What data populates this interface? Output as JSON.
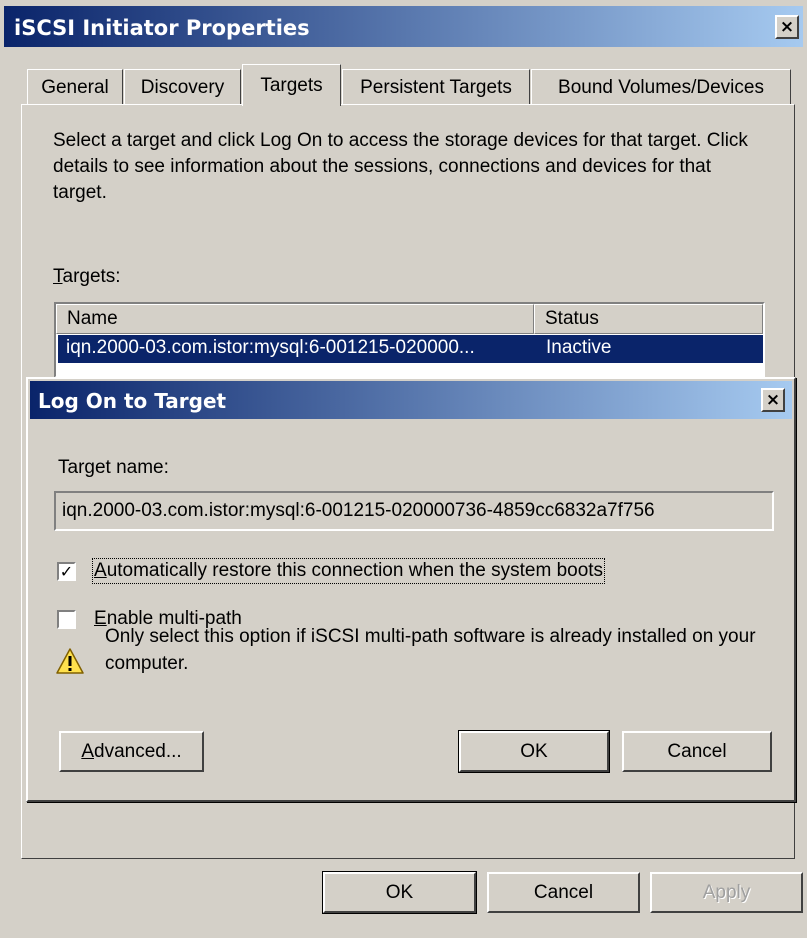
{
  "window": {
    "title": "iSCSI Initiator Properties",
    "close_label": "×",
    "tabs": [
      {
        "label": "General"
      },
      {
        "label": "Discovery"
      },
      {
        "label": "Targets"
      },
      {
        "label": "Persistent Targets"
      },
      {
        "label": "Bound Volumes/Devices"
      }
    ],
    "selected_tab": "Targets",
    "description": "Select a target and click Log On to access the storage devices for that target. Click details to see information about the sessions, connections and devices for that target.",
    "targets_label": {
      "mnemonic": "T",
      "rest": "argets:"
    },
    "list": {
      "columns": [
        "Name",
        "Status"
      ],
      "rows": [
        {
          "name": "iqn.2000-03.com.istor:mysql:6-001215-020000...",
          "status": "Inactive"
        }
      ]
    },
    "buttons": {
      "ok": "OK",
      "cancel": "Cancel",
      "apply": "Apply"
    }
  },
  "dialog": {
    "title": "Log On to Target",
    "close_label": "×",
    "target_name_label": "Target name:",
    "target_name_value": "iqn.2000-03.com.istor:mysql:6-001215-020000736-4859cc6832a7f756",
    "auto_restore": {
      "checked": true,
      "mark": "✓",
      "mnemonic": "A",
      "rest": "utomatically restore this connection when the system boots"
    },
    "multipath": {
      "checked": false,
      "mnemonic": "E",
      "rest": "nable multi-path"
    },
    "warning_icon": "warning-icon",
    "warning_text": "Only select this option if iSCSI multi-path software is already installed on your computer.",
    "advanced_button": {
      "mnemonic": "A",
      "rest": "dvanced..."
    },
    "ok_button": "OK",
    "cancel_button": "Cancel"
  }
}
